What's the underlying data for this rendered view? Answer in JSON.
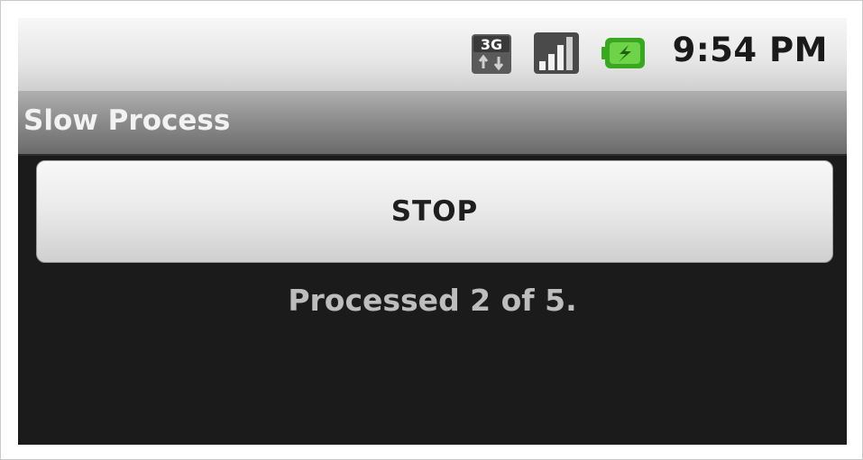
{
  "status_bar": {
    "network_label": "3G",
    "time": "9:54 PM",
    "icons": [
      "3g-data-icon",
      "signal-strength-icon",
      "battery-charging-icon"
    ]
  },
  "app": {
    "title": "Slow Process"
  },
  "main": {
    "stop_label": "STOP",
    "progress_text": "Processed 2 of 5.",
    "progress": {
      "processed": 2,
      "total": 5
    }
  },
  "colors": {
    "screen_background": "#1b1b1b",
    "status_bar": "#e6e6e6",
    "title_bar": "#8e8e8e",
    "battery_accent": "#38a81e",
    "progress_text": "#bdbdbd"
  }
}
